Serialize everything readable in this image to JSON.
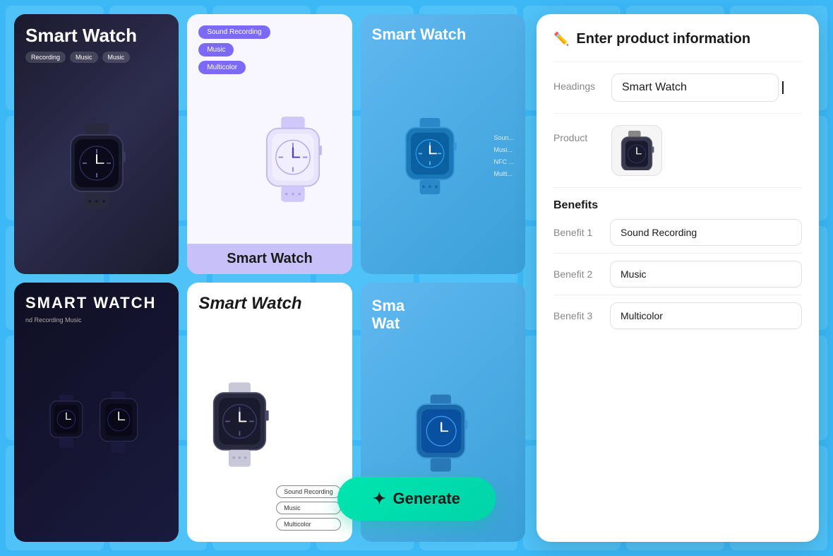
{
  "background": {
    "color": "#3bb8f5"
  },
  "cards": [
    {
      "id": 1,
      "theme": "dark",
      "title": "Smart Watch",
      "tags": [
        "Recording",
        "Music",
        "Music"
      ]
    },
    {
      "id": 2,
      "theme": "light-purple",
      "tags": [
        "Sound Recording",
        "Music",
        "Multicolor"
      ],
      "footer": "Smart Watch"
    },
    {
      "id": 3,
      "theme": "blue",
      "title": "Smart Watch",
      "subtitle_items": [
        "Soun...",
        "Musi...",
        "NFC ...",
        "Multi..."
      ]
    },
    {
      "id": 4,
      "theme": "dark2",
      "title": "SMART WATCH",
      "subtitle": "nd Recording    Music"
    },
    {
      "id": 5,
      "theme": "white-italic",
      "title": "Smart Watch",
      "tags": [
        "Sound Recording",
        "Music",
        "Multicolor"
      ]
    },
    {
      "id": 6,
      "theme": "blue2",
      "title": "Sma\nWat"
    }
  ],
  "bg_card": {
    "title": "Smart Watch"
  },
  "panel": {
    "header": {
      "icon": "✏️",
      "title": "Enter product information"
    },
    "fields": {
      "headings_label": "Headings",
      "headings_value": "Smart Watch",
      "product_label": "Product"
    },
    "benefits": {
      "section_title": "Benefits",
      "items": [
        {
          "label": "Benefit 1",
          "value": "Sound Recording"
        },
        {
          "label": "Benefit 2",
          "value": "Music"
        },
        {
          "label": "Benefit 3",
          "value": "Multicolor"
        }
      ]
    }
  },
  "generate_button": {
    "label": "Generate",
    "icon": "✦"
  }
}
